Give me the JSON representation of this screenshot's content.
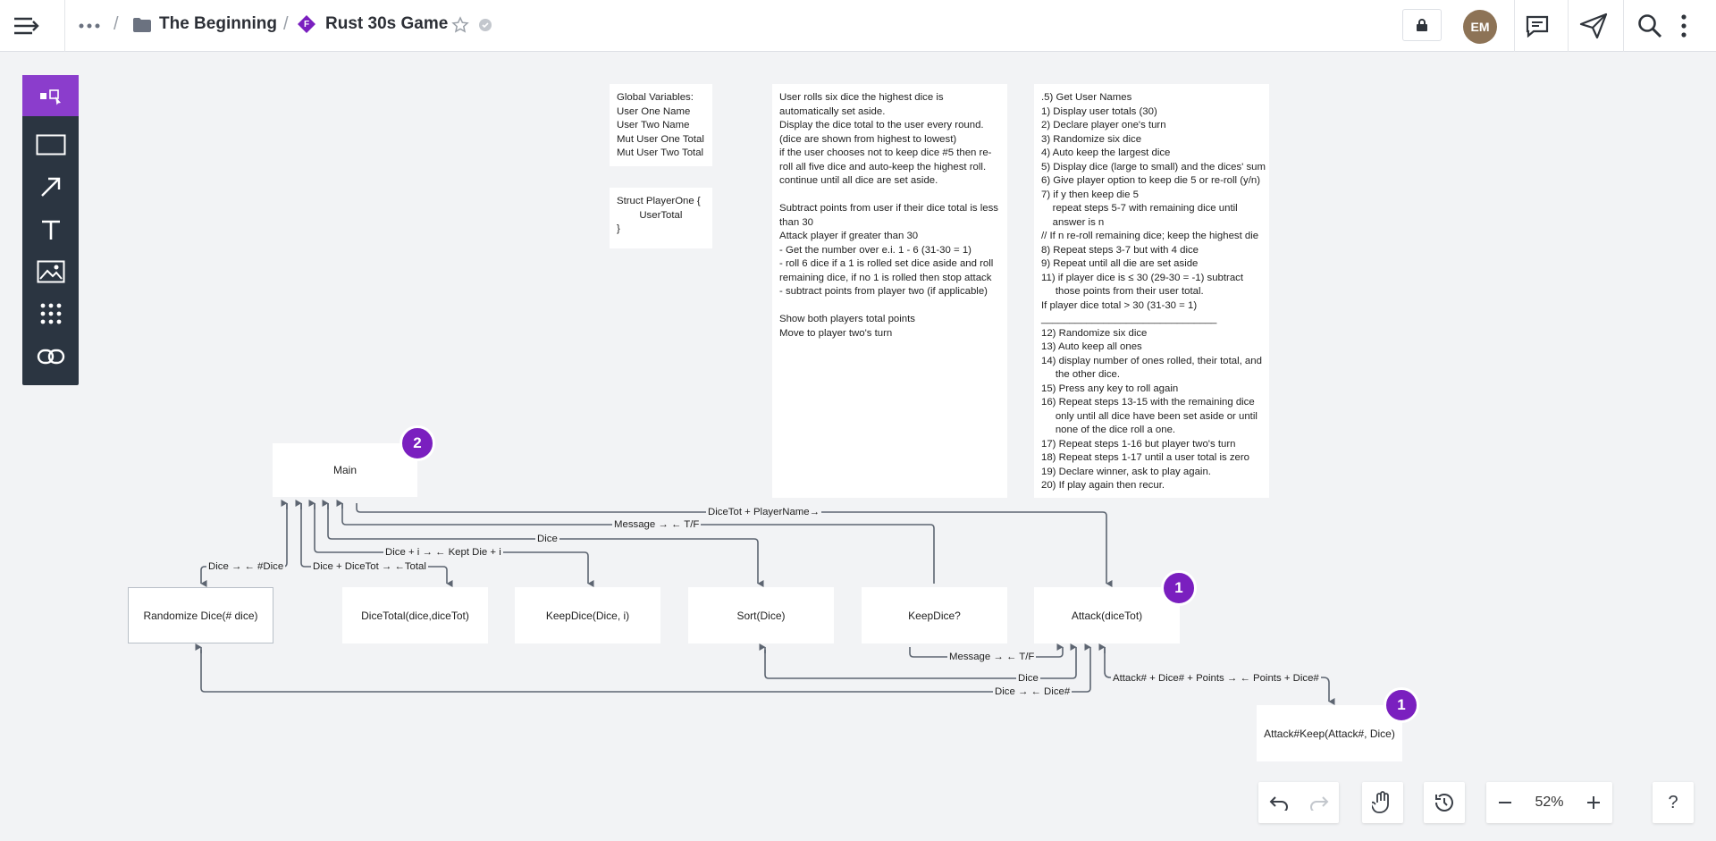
{
  "header": {
    "folder": "The Beginning",
    "board_title": "Rust 30s Game",
    "board_badge_letter": "F",
    "avatar_initials": "EM"
  },
  "notes": {
    "globals": [
      "Global Variables:",
      "User One Name",
      "User Two Name",
      "Mut User One Total",
      "Mut User Two Total"
    ],
    "struct": [
      "Struct PlayerOne {",
      "        UserTotal",
      "}"
    ],
    "rules": [
      "User rolls six dice the highest dice is",
      "automatically set aside.",
      "Display the dice total to the user every round.",
      "(dice are shown from highest to lowest)",
      "if the user chooses not to keep dice #5 then re-",
      "roll all five dice and auto-keep the highest roll.",
      "continue until all dice are set aside.",
      "",
      "Subtract points from user if their dice total is less",
      "than 30",
      "Attack player if greater than 30",
      "- Get the number over e.i. 1 - 6 (31-30 = 1)",
      "- roll 6 dice if a 1 is rolled set dice aside and roll",
      "remaining dice, if no 1 is rolled then stop attack",
      "- subtract points from player two (if applicable)",
      "",
      "Show both players total points",
      "Move to player two's turn"
    ],
    "steps": [
      ".5) Get User Names",
      "1) Display user totals (30)",
      "2) Declare player one's turn",
      "3) Randomize six dice",
      "4) Auto keep the largest dice",
      "5) Display dice (large to small) and the dices' sum",
      "6) Give player option to keep die 5 or re-roll (y/n)",
      "7) if y then keep die 5",
      "    repeat steps 5-7 with remaining dice until",
      "    answer is n",
      "// If n re-roll remaining dice; keep the highest die",
      "8) Repeat steps 3-7 but with 4 dice",
      "9) Repeat until all die are set aside",
      "11) if player dice is ≤ 30 (29-30 = -1) subtract",
      "     those points from their user total.",
      "If player dice total > 30 (31-30 = 1)",
      "_______________________________",
      "12) Randomize six dice",
      "13) Auto keep all ones",
      "14) display number of ones rolled, their total, and",
      "     the other dice.",
      "15) Press any key to roll again",
      "16) Repeat steps 13-15 with the remaining dice",
      "     only until all dice have been set aside or until",
      "     none of the dice roll a one.",
      "17) Repeat steps 1-16 but player two's turn",
      "18) Repeat steps 1-17 until a user total is zero",
      "19) Declare winner, ask to play again.",
      "20) If play again then recur."
    ]
  },
  "boxes": {
    "main": "Main",
    "randomize": "Randomize Dice(# dice)",
    "dicetotal": "DiceTotal(dice,diceTot)",
    "keepdice": "KeepDice(Dice, i)",
    "sort": "Sort(Dice)",
    "keepq": "KeepDice?",
    "attack": "Attack(diceTot)",
    "attackkeep": "Attack#Keep(Attack#, Dice)"
  },
  "badges": {
    "main": "2",
    "attack": "1",
    "attackkeep": "1"
  },
  "connectors": {
    "l1": "DiceTot + PlayerName→",
    "l2": "Message → ← T/F",
    "l3": "Dice",
    "l4": "Dice + i → ← Kept Die + i",
    "l5": "Dice → ← #Dice",
    "l6": "Dice + DiceTot → ←Total",
    "l7": "Message → ← T/F",
    "l8": "Dice",
    "l9": "Attack# + Dice# + Points → ← Points + Dice#",
    "l10": "Dice → ← Dice#"
  },
  "controls": {
    "zoom": "52%",
    "help": "?"
  }
}
